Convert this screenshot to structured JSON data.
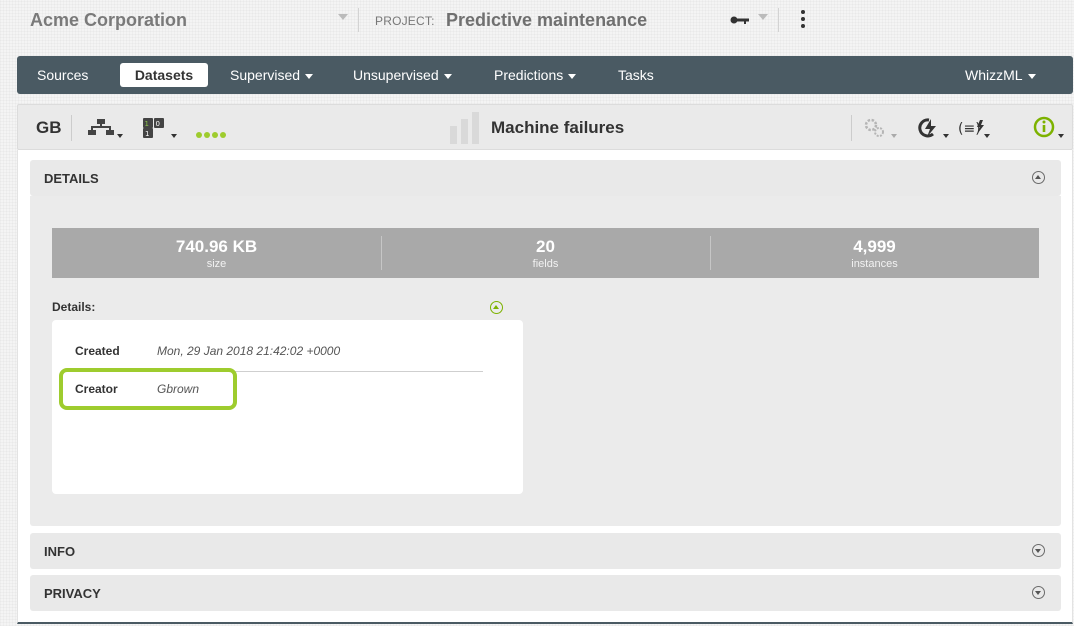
{
  "header": {
    "organization": "Acme Corporation",
    "project_label": "PROJECT:",
    "project_name": "Predictive maintenance"
  },
  "nav": {
    "items": [
      {
        "label": "Sources",
        "active": false,
        "caret": false
      },
      {
        "label": "Datasets",
        "active": true,
        "caret": false
      },
      {
        "label": "Supervised",
        "active": false,
        "caret": true
      },
      {
        "label": "Unsupervised",
        "active": false,
        "caret": true
      },
      {
        "label": "Predictions",
        "active": false,
        "caret": true
      },
      {
        "label": "Tasks",
        "active": false,
        "caret": false
      }
    ],
    "right": "WhizzML"
  },
  "toolbar": {
    "owner_initials": "GB",
    "dataset_name": "Machine failures",
    "icons": [
      "tree-model-icon",
      "dataset-ops-icon",
      "progress-dots-icon",
      "configure-icon",
      "one-click-icon",
      "whizzml-script-icon",
      "info-icon"
    ]
  },
  "panels": {
    "details": "DETAILS",
    "info": "INFO",
    "privacy": "PRIVACY"
  },
  "stats": [
    {
      "value": "740.96 KB",
      "label": "size"
    },
    {
      "value": "20",
      "label": "fields"
    },
    {
      "value": "4,999",
      "label": "instances"
    }
  ],
  "details": {
    "heading": "Details:",
    "rows": [
      {
        "key": "Created",
        "value": "Mon, 29 Jan 2018 21:42:02 +0000"
      },
      {
        "key": "Creator",
        "value": "Gbrown"
      }
    ]
  },
  "colors": {
    "nav_bg": "#4a5a63",
    "accent_green": "#9ecc2e",
    "stats_bg": "#a9a9a9"
  }
}
